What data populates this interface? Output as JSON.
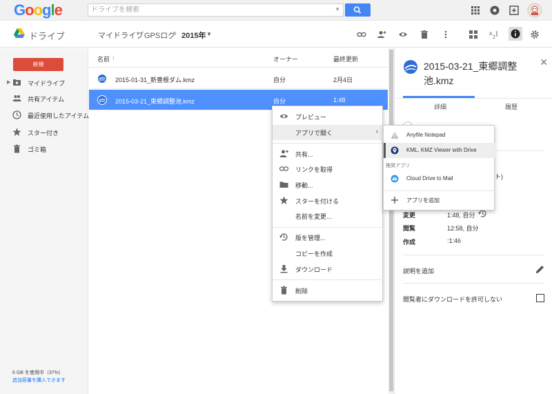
{
  "header": {
    "logo_letters": [
      "G",
      "o",
      "o",
      "g",
      "l",
      "e"
    ],
    "search_placeholder": "ドライブを検索"
  },
  "toolbar": {
    "app_title": "ドライブ",
    "breadcrumb": [
      "マイドライブ",
      "GPSログ",
      "2015年"
    ]
  },
  "sidebar": {
    "new_label": "新規",
    "items": [
      {
        "label": "マイドライブ",
        "icon": "my-drive-icon"
      },
      {
        "label": "共有アイテム",
        "icon": "shared-icon"
      },
      {
        "label": "最近使用したアイテム",
        "icon": "clock-icon"
      },
      {
        "label": "スター付き",
        "icon": "star-icon"
      },
      {
        "label": "ゴミ箱",
        "icon": "trash-icon"
      }
    ],
    "storage_used": "6 GB を使用中（37%）",
    "storage_link": "追加容量を購入できます"
  },
  "list": {
    "col_name": "名前",
    "col_name_sort": "↑",
    "col_owner": "オーナー",
    "col_modified": "最終更新",
    "rows": [
      {
        "name": "2015-01-31_新豊根ダム.kmz",
        "owner": "自分",
        "modified": "2月4日"
      },
      {
        "name": "2015-03-21_東郷調整池.kmz",
        "owner": "自分",
        "modified": "1:48"
      }
    ]
  },
  "context_menu": {
    "items": [
      {
        "label": "プレビュー",
        "icon": "eye-icon"
      },
      {
        "label": "アプリで開く",
        "icon": "",
        "submenu": "›"
      },
      {
        "label": "共有...",
        "icon": "share-icon"
      },
      {
        "label": "リンクを取得",
        "icon": "link-icon"
      },
      {
        "label": "移動...",
        "icon": "folder-icon"
      },
      {
        "label": "スターを付ける",
        "icon": "star-icon"
      },
      {
        "label": "名前を変更...",
        "icon": ""
      },
      {
        "label": "版を管理...",
        "icon": "history-icon"
      },
      {
        "label": "コピーを作成",
        "icon": ""
      },
      {
        "label": "ダウンロード",
        "icon": "download-icon"
      },
      {
        "label": "削除",
        "icon": "trash-icon"
      }
    ]
  },
  "submenu": {
    "apps": [
      {
        "label": "Anyfile Notepad",
        "icon": "warning-icon"
      },
      {
        "label": "KML, KMZ Viewer with Drive",
        "icon": "map-pin-icon"
      }
    ],
    "suggested_heading": "推奨アプリ",
    "suggested": [
      {
        "label": "Cloud Drive to Mail",
        "icon": "mail-app-icon"
      }
    ],
    "add_app": {
      "label": "アプリを追加",
      "icon": "plus-icon"
    }
  },
  "details": {
    "title": "2015-03-21_東郷調整池.kmz",
    "tab_details": "詳細",
    "tab_activity": "履歴",
    "fragment": "ト)",
    "modified_label": "変更",
    "modified_value": "1:48, 自分",
    "opened_label": "閲覧",
    "opened_value": "12:58, 自分",
    "created_label": "作成",
    "created_value": ":1:46",
    "add_description": "説明を追加",
    "disable_download": "閲覧者にダウンロードを許可しない"
  },
  "colors": {
    "accent": "#4285f4",
    "selected_row": "#4d90fe",
    "new_button": "#dd4b39"
  }
}
